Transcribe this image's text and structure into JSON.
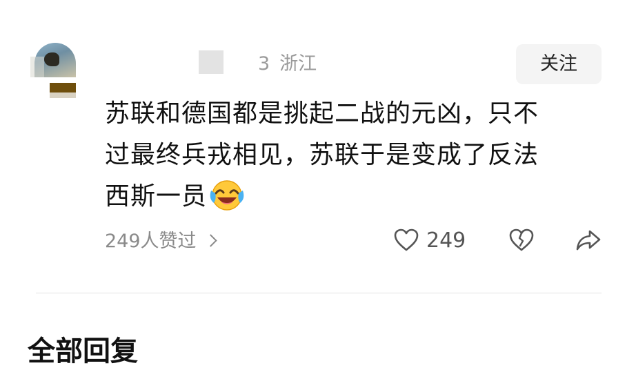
{
  "comment_card": {
    "user": {
      "name": "",
      "level": "3",
      "location": "浙江"
    },
    "follow_label": "关注",
    "text_lines": [
      "苏联和德国都是挑起二战的元凶，只不",
      "过最终兵戎相见，苏联于是变成了反法",
      "西斯一员"
    ],
    "emoji": "laughing-crying-emoji",
    "likes_summary": "249人赞过",
    "like_count": "249"
  },
  "replies": {
    "title": "全部回复"
  },
  "colors": {
    "secondary_text": "#9a9a9a",
    "button_bg": "#f4f4f4",
    "divider": "#e2e2e2",
    "icon": "#555555"
  }
}
